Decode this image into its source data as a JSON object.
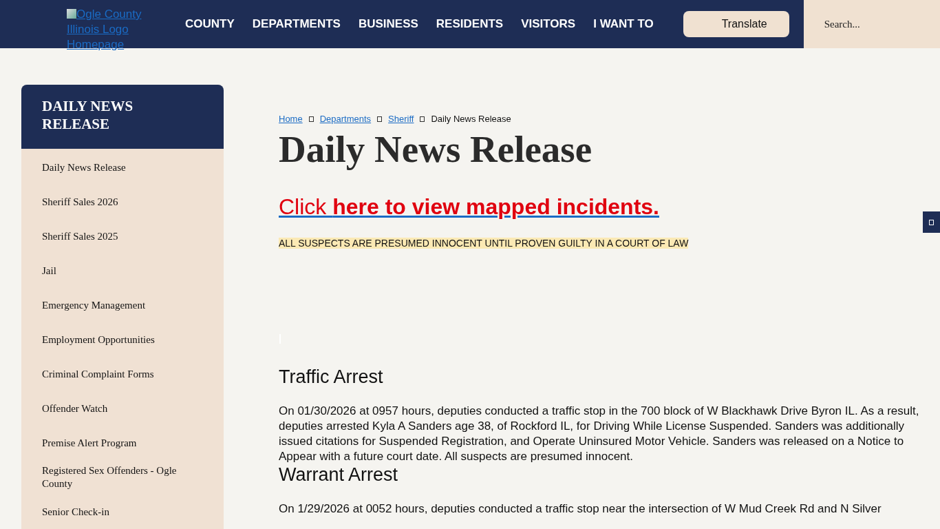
{
  "header": {
    "logo_alt": "Ogle County Illinois Logo Homepage",
    "nav": [
      "COUNTY",
      "DEPARTMENTS",
      "BUSINESS",
      "RESIDENTS",
      "VISITORS",
      "I WANT TO"
    ],
    "translate": "Translate",
    "search": {
      "placeholder": "Search..."
    }
  },
  "sidebar": {
    "title": "DAILY NEWS RELEASE",
    "items": [
      {
        "label": "Daily News Release"
      },
      {
        "label": "Sheriff Sales 2026"
      },
      {
        "label": "Sheriff Sales 2025"
      },
      {
        "label": "Jail"
      },
      {
        "label": "Emergency Management"
      },
      {
        "label": "Employment Opportunities"
      },
      {
        "label": "Criminal Complaint Forms"
      },
      {
        "label": "Offender Watch"
      },
      {
        "label": "Premise Alert Program"
      },
      {
        "label": "Registered Sex Offenders - Ogle County"
      },
      {
        "label": "Senior Check-in"
      }
    ]
  },
  "breadcrumb": [
    {
      "label": "Home",
      "kind": "link"
    },
    {
      "label": "Departments",
      "kind": "link"
    },
    {
      "label": "Sheriff",
      "kind": "link"
    },
    {
      "label": "Daily News Release",
      "kind": "current"
    }
  ],
  "title": "Daily News Release",
  "map_link": "Click **here to view mapped incidents.**",
  "notice": "ALL SUSPECTS ARE PRESUMED INNOCENT UNTIL PROVEN GUILTY IN A COURT OF LAW",
  "articles": [
    {
      "heading": "Traffic Arrest",
      "body": "On 01/30/2026 at 0957 hours, deputies conducted a traffic stop in the 700 block of W Blackhawk Drive Byron IL. As a result, deputies arrested Kyla A Sanders age 38, of Rockford IL, for Driving While License Suspended. Sanders was additionally issued citations for Suspended Registration, and Operate Uninsured Motor Vehicle. Sanders was released on a Notice to Appear with a future court date. All suspects are presumed innocent."
    },
    {
      "heading": "Warrant Arrest",
      "body": "On 1/29/2026 at 0052 hours, deputies conducted a traffic stop near the intersection of W Mud Creek Rd and N Silver"
    }
  ]
}
